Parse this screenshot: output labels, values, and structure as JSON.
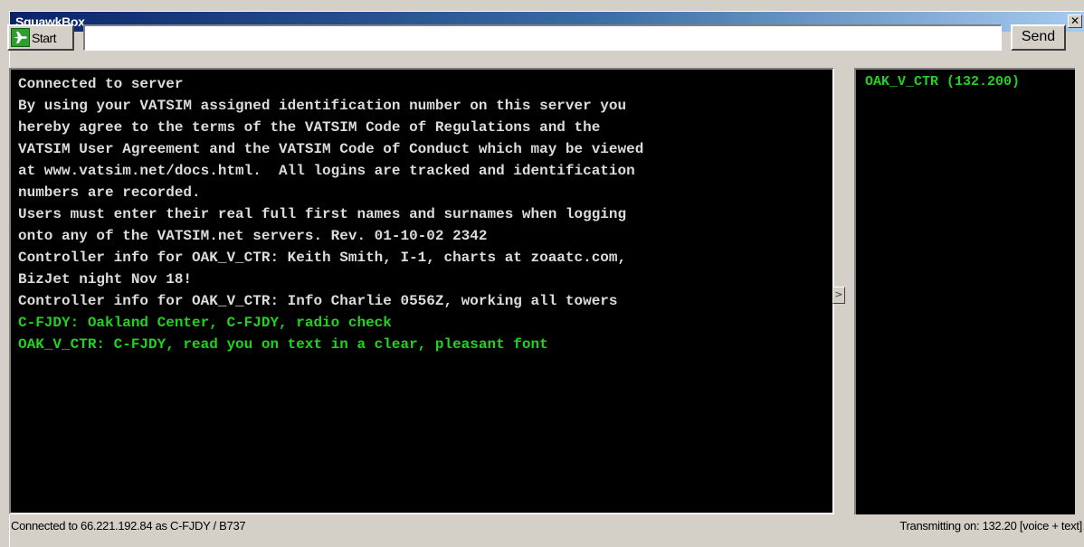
{
  "window": {
    "title": "SquawkBox",
    "close_glyph": "✕"
  },
  "toolbar": {
    "start_label": "Start",
    "start_icon": "airplane-icon",
    "message_value": "",
    "send_label": "Send"
  },
  "chat": {
    "lines": [
      {
        "text": "Connected to server",
        "color": "#dcdcdc"
      },
      {
        "text": "By using your VATSIM assigned identification number on this server you",
        "color": "#dcdcdc"
      },
      {
        "text": "hereby agree to the terms of the VATSIM Code of Regulations and the",
        "color": "#dcdcdc"
      },
      {
        "text": "VATSIM User Agreement and the VATSIM Code of Conduct which may be viewed",
        "color": "#dcdcdc"
      },
      {
        "text": "at www.vatsim.net/docs.html.  All logins are tracked and identification",
        "color": "#dcdcdc"
      },
      {
        "text": "numbers are recorded.",
        "color": "#dcdcdc"
      },
      {
        "text": "Users must enter their real full first names and surnames when logging",
        "color": "#dcdcdc"
      },
      {
        "text": "onto any of the VATSIM.net servers. Rev. 01-10-02 2342",
        "color": "#dcdcdc"
      },
      {
        "text": "Controller info for OAK_V_CTR: Keith Smith, I-1, charts at zoaatc.com,",
        "color": "#dcdcdc"
      },
      {
        "text": "BizJet night Nov 18!",
        "color": "#dcdcdc"
      },
      {
        "text": "Controller info for OAK_V_CTR: Info Charlie 0556Z, working all towers",
        "color": "#dcdcdc"
      },
      {
        "text": "C-FJDY: Oakland Center, C-FJDY, radio check",
        "color": "#1fd41f"
      },
      {
        "text": "OAK_V_CTR: C-FJDY, read you on text in a clear, pleasant font",
        "color": "#1fd41f"
      }
    ]
  },
  "splitter": {
    "glyph": ">"
  },
  "atc_list": {
    "entries": [
      "OAK_V_CTR (132.200)"
    ]
  },
  "status": {
    "left": "Connected to 66.221.192.84 as C-FJDY / B737",
    "right": "Transmitting on: 132.20 [voice + text]"
  }
}
